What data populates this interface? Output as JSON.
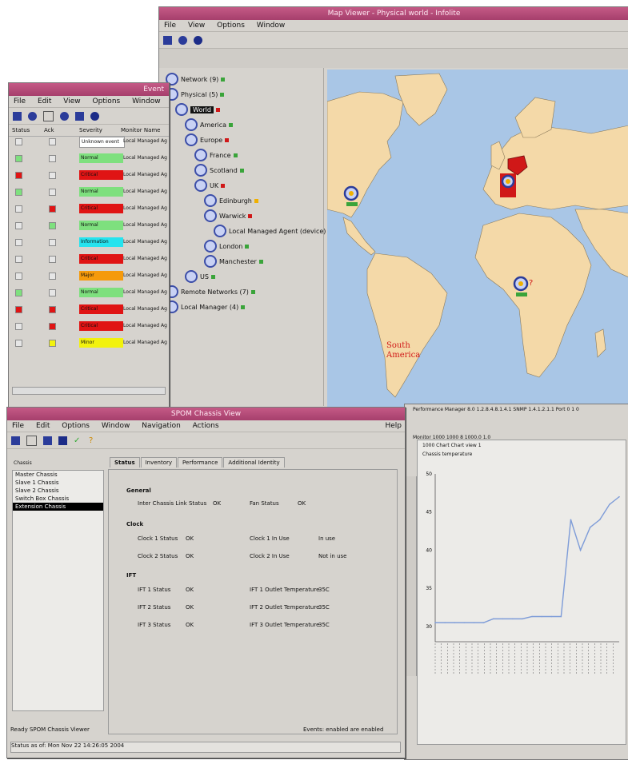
{
  "map_window": {
    "title": "Map Viewer - Physical world - Infolite",
    "menu": [
      "File",
      "View",
      "Options",
      "Window"
    ],
    "toolbar_icons": [
      "tree-icon",
      "home-icon",
      "help-icon"
    ],
    "tree": [
      {
        "label": "Network (9)",
        "level": 0
      },
      {
        "label": "Physical (5)",
        "level": 0
      },
      {
        "label": "World",
        "level": 1
      },
      {
        "label": "America",
        "level": 2
      },
      {
        "label": "Europe",
        "level": 2
      },
      {
        "label": "France",
        "level": 3
      },
      {
        "label": "Scotland",
        "level": 3
      },
      {
        "label": "UK",
        "level": 3
      },
      {
        "label": "Edinburgh",
        "level": 4
      },
      {
        "label": "Warwick",
        "level": 4
      },
      {
        "label": "Local Managed Agent (device)",
        "level": 5
      },
      {
        "label": "London",
        "level": 4
      },
      {
        "label": "Manchester",
        "level": 4
      },
      {
        "label": "US",
        "level": 2
      },
      {
        "label": "Remote Networks (7)",
        "level": 0
      },
      {
        "label": "Local Manager (4)",
        "level": 0
      }
    ],
    "map_labels": {
      "south_america": "South America"
    },
    "map_markers": [
      {
        "name": "america-node",
        "status_color": "#3aa43a"
      },
      {
        "name": "europe-node",
        "status_color": "#d01818"
      },
      {
        "name": "africa-node",
        "status_color": "#3aa43a"
      }
    ]
  },
  "table_window": {
    "title": "Event",
    "menu": [
      "File",
      "Edit",
      "View",
      "Options",
      "Window"
    ],
    "headers": [
      "Status",
      "Ack",
      "Severity",
      "Monitor Name"
    ],
    "rows": [
      {
        "sev": "Unknown event",
        "color": "#ffffff",
        "mon": "Local Managed Ag",
        "status": "none",
        "ack": "none"
      },
      {
        "sev": "Normal",
        "color": "#7ee07e",
        "mon": "Local Managed Ag",
        "status": "green",
        "ack": "none"
      },
      {
        "sev": "Critical",
        "color": "#e01414",
        "mon": "Local Managed Ag",
        "status": "red",
        "ack": "none"
      },
      {
        "sev": "Normal",
        "color": "#7ee07e",
        "mon": "Local Managed Ag",
        "status": "green",
        "ack": "none"
      },
      {
        "sev": "Critical",
        "color": "#e01414",
        "mon": "Local Managed Ag",
        "status": "none",
        "ack": "red"
      },
      {
        "sev": "Normal",
        "color": "#7ee07e",
        "mon": "Local Managed Ag",
        "status": "none",
        "ack": "green"
      },
      {
        "sev": "Information",
        "color": "#26e3ee",
        "mon": "Local Managed Ag",
        "status": "none",
        "ack": "none"
      },
      {
        "sev": "Critical",
        "color": "#e01414",
        "mon": "Local Managed Ag",
        "status": "none",
        "ack": "none"
      },
      {
        "sev": "Major",
        "color": "#f59a0c",
        "mon": "Local Managed Ag",
        "status": "none",
        "ack": "none"
      },
      {
        "sev": "Normal",
        "color": "#7ee07e",
        "mon": "Local Managed Ag",
        "status": "green",
        "ack": "none"
      },
      {
        "sev": "Critical",
        "color": "#e01414",
        "mon": "Local Managed Ag",
        "status": "red",
        "ack": "red"
      },
      {
        "sev": "Critical",
        "color": "#e01414",
        "mon": "Local Managed Ag",
        "status": "none",
        "ack": "red"
      },
      {
        "sev": "Minor",
        "color": "#f2f20e",
        "mon": "Local Managed Ag",
        "status": "none",
        "ack": "yellow"
      }
    ]
  },
  "chassis_window": {
    "title": "SPOM Chassis View",
    "menu": [
      "File",
      "Edit",
      "Options",
      "Window",
      "Navigation",
      "Actions"
    ],
    "help": "Help",
    "list_header": "Chassis",
    "list_items": [
      "Master Chassis",
      "Slave 1 Chassis",
      "Slave 2 Chassis",
      "Switch Box Chassis",
      "Extension Chassis"
    ],
    "tabs": [
      "Status",
      "Inventory",
      "Performance",
      "Additional Identity"
    ],
    "groups": {
      "general": "General",
      "clock": "Clock",
      "ift": "IFT"
    },
    "general_row": {
      "l1": "Inter Chassis Link Status",
      "v1": "OK",
      "l2": "Fan Status",
      "v2": "OK"
    },
    "clock_rows": [
      {
        "l1": "Clock 1 Status",
        "v1": "OK",
        "l2": "Clock 1 In Use",
        "v2": "In use"
      },
      {
        "l1": "Clock 2 Status",
        "v1": "OK",
        "l2": "Clock 2 In Use",
        "v2": "Not in use"
      }
    ],
    "ift_rows": [
      {
        "l1": "IFT 1 Status",
        "v1": "OK",
        "l2": "IFT 1 Outlet Temperature",
        "v2": "35C"
      },
      {
        "l1": "IFT 2 Status",
        "v1": "OK",
        "l2": "IFT 2 Outlet Temperature",
        "v2": "35C"
      },
      {
        "l1": "IFT 3 Status",
        "v1": "OK",
        "l2": "IFT 3 Outlet Temperature",
        "v2": "35C"
      }
    ],
    "status_left": "Ready  SPOM Chassis Viewer",
    "status_right": "Events: enabled  are enabled",
    "status_bottom": "Status as of: Mon Nov 22 14:26:05 2004"
  },
  "perf_window": {
    "title": "Performance Manager 8.0  1.2.8.4.8.1.4.1  SNMP 1.4.1.2.1.1 Port 0 1 0",
    "subtitle": "Monitor 1000 1000 8 1000.0 1.0",
    "chart_header": "1000  Chart  Chart view 1",
    "chart_note": "Chassis temperature",
    "y_ticks": [
      "50",
      "45",
      "40",
      "35",
      "30"
    ],
    "series_color": "#7e9cd8"
  },
  "chart_data": {
    "type": "line",
    "series": [
      {
        "values": [
          30.5,
          30.5,
          30.5,
          30.5,
          30.5,
          30.5,
          31,
          31,
          31,
          31,
          31.3,
          31.3,
          31.3,
          31.3,
          44,
          40,
          43,
          44,
          46,
          47
        ]
      }
    ],
    "ylim": [
      28,
      50
    ],
    "grid": false
  }
}
